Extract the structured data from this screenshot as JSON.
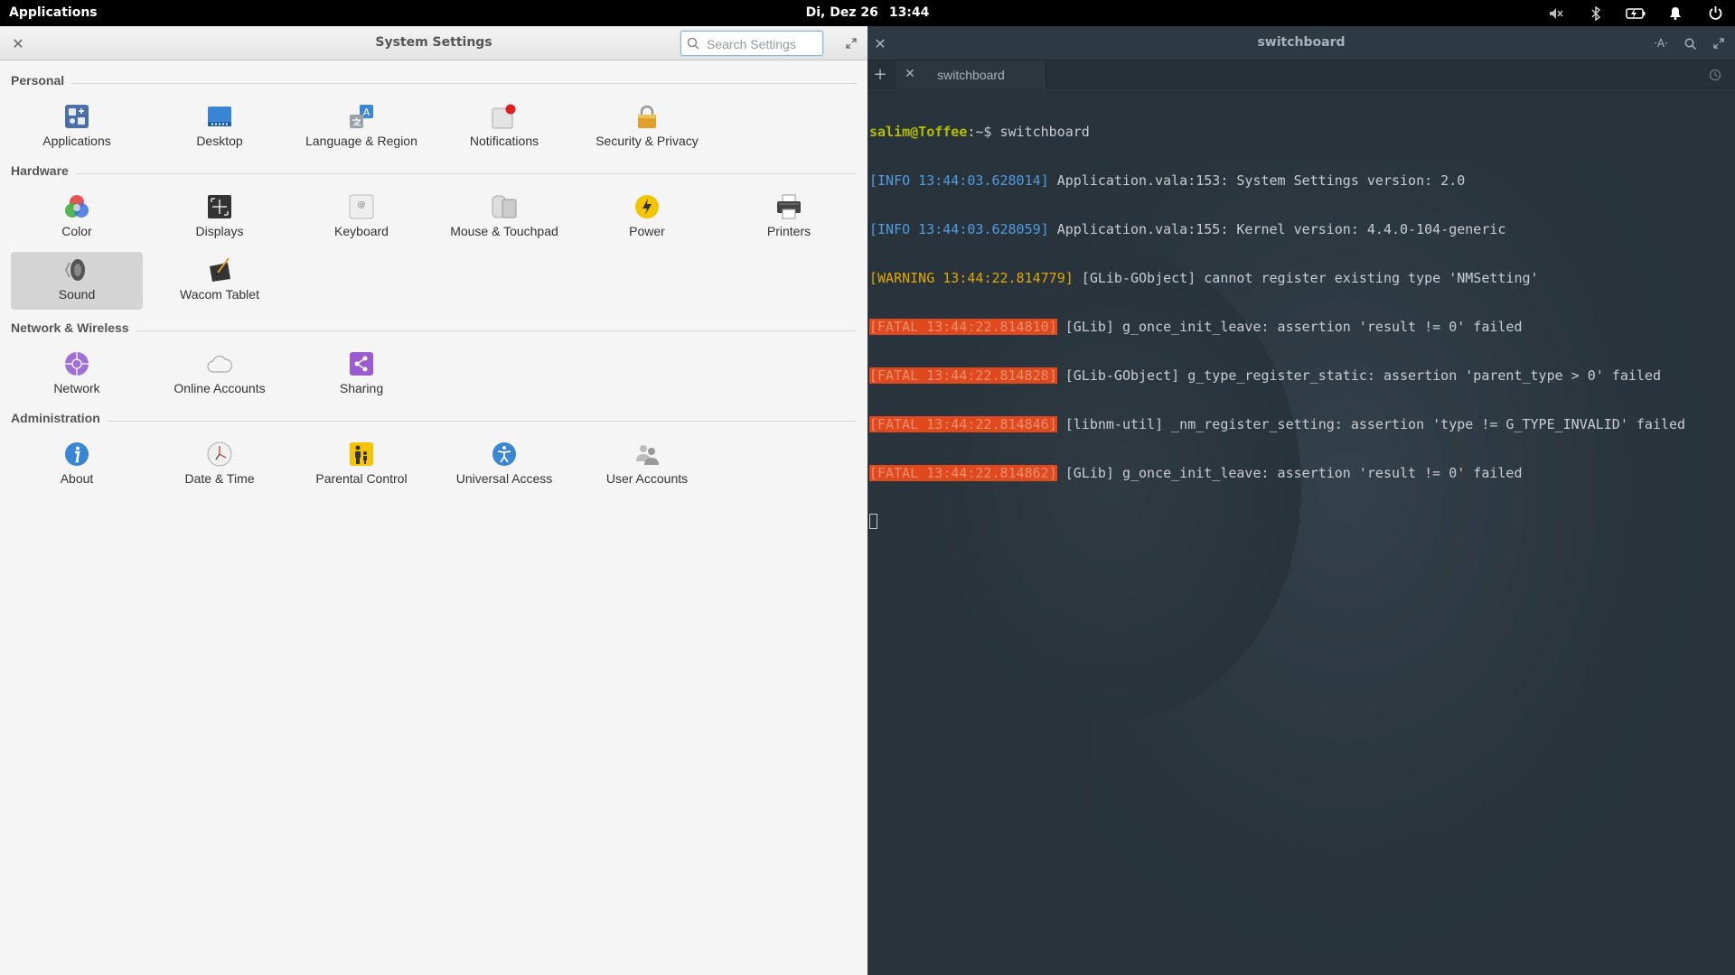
{
  "top_panel": {
    "applications": "Applications",
    "date": "Di, Dez 26",
    "time": "13:44",
    "indicators": [
      "sound-muted-icon",
      "bluetooth-icon",
      "battery-icon",
      "notifications-icon",
      "power-icon"
    ]
  },
  "settings": {
    "title": "System Settings",
    "search_placeholder": "Search Settings",
    "sections": [
      {
        "name": "Personal",
        "items": [
          {
            "label": "Applications",
            "icon": "applications-icon"
          },
          {
            "label": "Desktop",
            "icon": "desktop-icon"
          },
          {
            "label": "Language & Region",
            "icon": "language-icon"
          },
          {
            "label": "Notifications",
            "icon": "notifications-icon"
          },
          {
            "label": "Security & Privacy",
            "icon": "lock-icon"
          }
        ]
      },
      {
        "name": "Hardware",
        "items": [
          {
            "label": "Color",
            "icon": "color-icon"
          },
          {
            "label": "Displays",
            "icon": "displays-icon"
          },
          {
            "label": "Keyboard",
            "icon": "keyboard-icon"
          },
          {
            "label": "Mouse & Touchpad",
            "icon": "mouse-icon"
          },
          {
            "label": "Power",
            "icon": "power-icon"
          },
          {
            "label": "Printers",
            "icon": "printer-icon"
          },
          {
            "label": "Sound",
            "icon": "speaker-icon",
            "selected": true
          },
          {
            "label": "Wacom Tablet",
            "icon": "tablet-icon"
          }
        ]
      },
      {
        "name": "Network & Wireless",
        "items": [
          {
            "label": "Network",
            "icon": "network-icon"
          },
          {
            "label": "Online Accounts",
            "icon": "cloud-icon"
          },
          {
            "label": "Sharing",
            "icon": "share-icon"
          }
        ]
      },
      {
        "name": "Administration",
        "items": [
          {
            "label": "About",
            "icon": "info-icon"
          },
          {
            "label": "Date & Time",
            "icon": "clock-icon"
          },
          {
            "label": "Parental Control",
            "icon": "parental-icon"
          },
          {
            "label": "Universal Access",
            "icon": "accessibility-icon"
          },
          {
            "label": "User Accounts",
            "icon": "users-icon"
          }
        ]
      }
    ]
  },
  "terminal": {
    "title": "switchboard",
    "tab_label": "switchboard",
    "prompt_user": "salim@Toffee",
    "prompt_rest": ":~$ switchboard",
    "lines": [
      {
        "tag": "[INFO 13:44:03.628014]",
        "kind": "info",
        "text": " Application.vala:153: System Settings version: 2.0"
      },
      {
        "tag": "[INFO 13:44:03.628059]",
        "kind": "info",
        "text": " Application.vala:155: Kernel version: 4.4.0-104-generic"
      },
      {
        "tag": "[WARNING 13:44:22.814779]",
        "kind": "warn",
        "text": " [GLib-GObject] cannot register existing type 'NMSetting'"
      },
      {
        "tag": "[FATAL 13:44:22.814810]",
        "kind": "fatal",
        "text": " [GLib] g_once_init_leave: assertion 'result != 0' failed"
      },
      {
        "tag": "[FATAL 13:44:22.814828]",
        "kind": "fatal",
        "text": " [GLib-GObject] g_type_register_static: assertion 'parent_type > 0' failed"
      },
      {
        "tag": "[FATAL 13:44:22.814846]",
        "kind": "fatal",
        "text": " [libnm-util] _nm_register_setting: assertion 'type != G_TYPE_INVALID' failed"
      },
      {
        "tag": "[FATAL 13:44:22.814862]",
        "kind": "fatal",
        "text": " [GLib] g_once_init_leave: assertion 'result != 0' failed"
      }
    ]
  }
}
